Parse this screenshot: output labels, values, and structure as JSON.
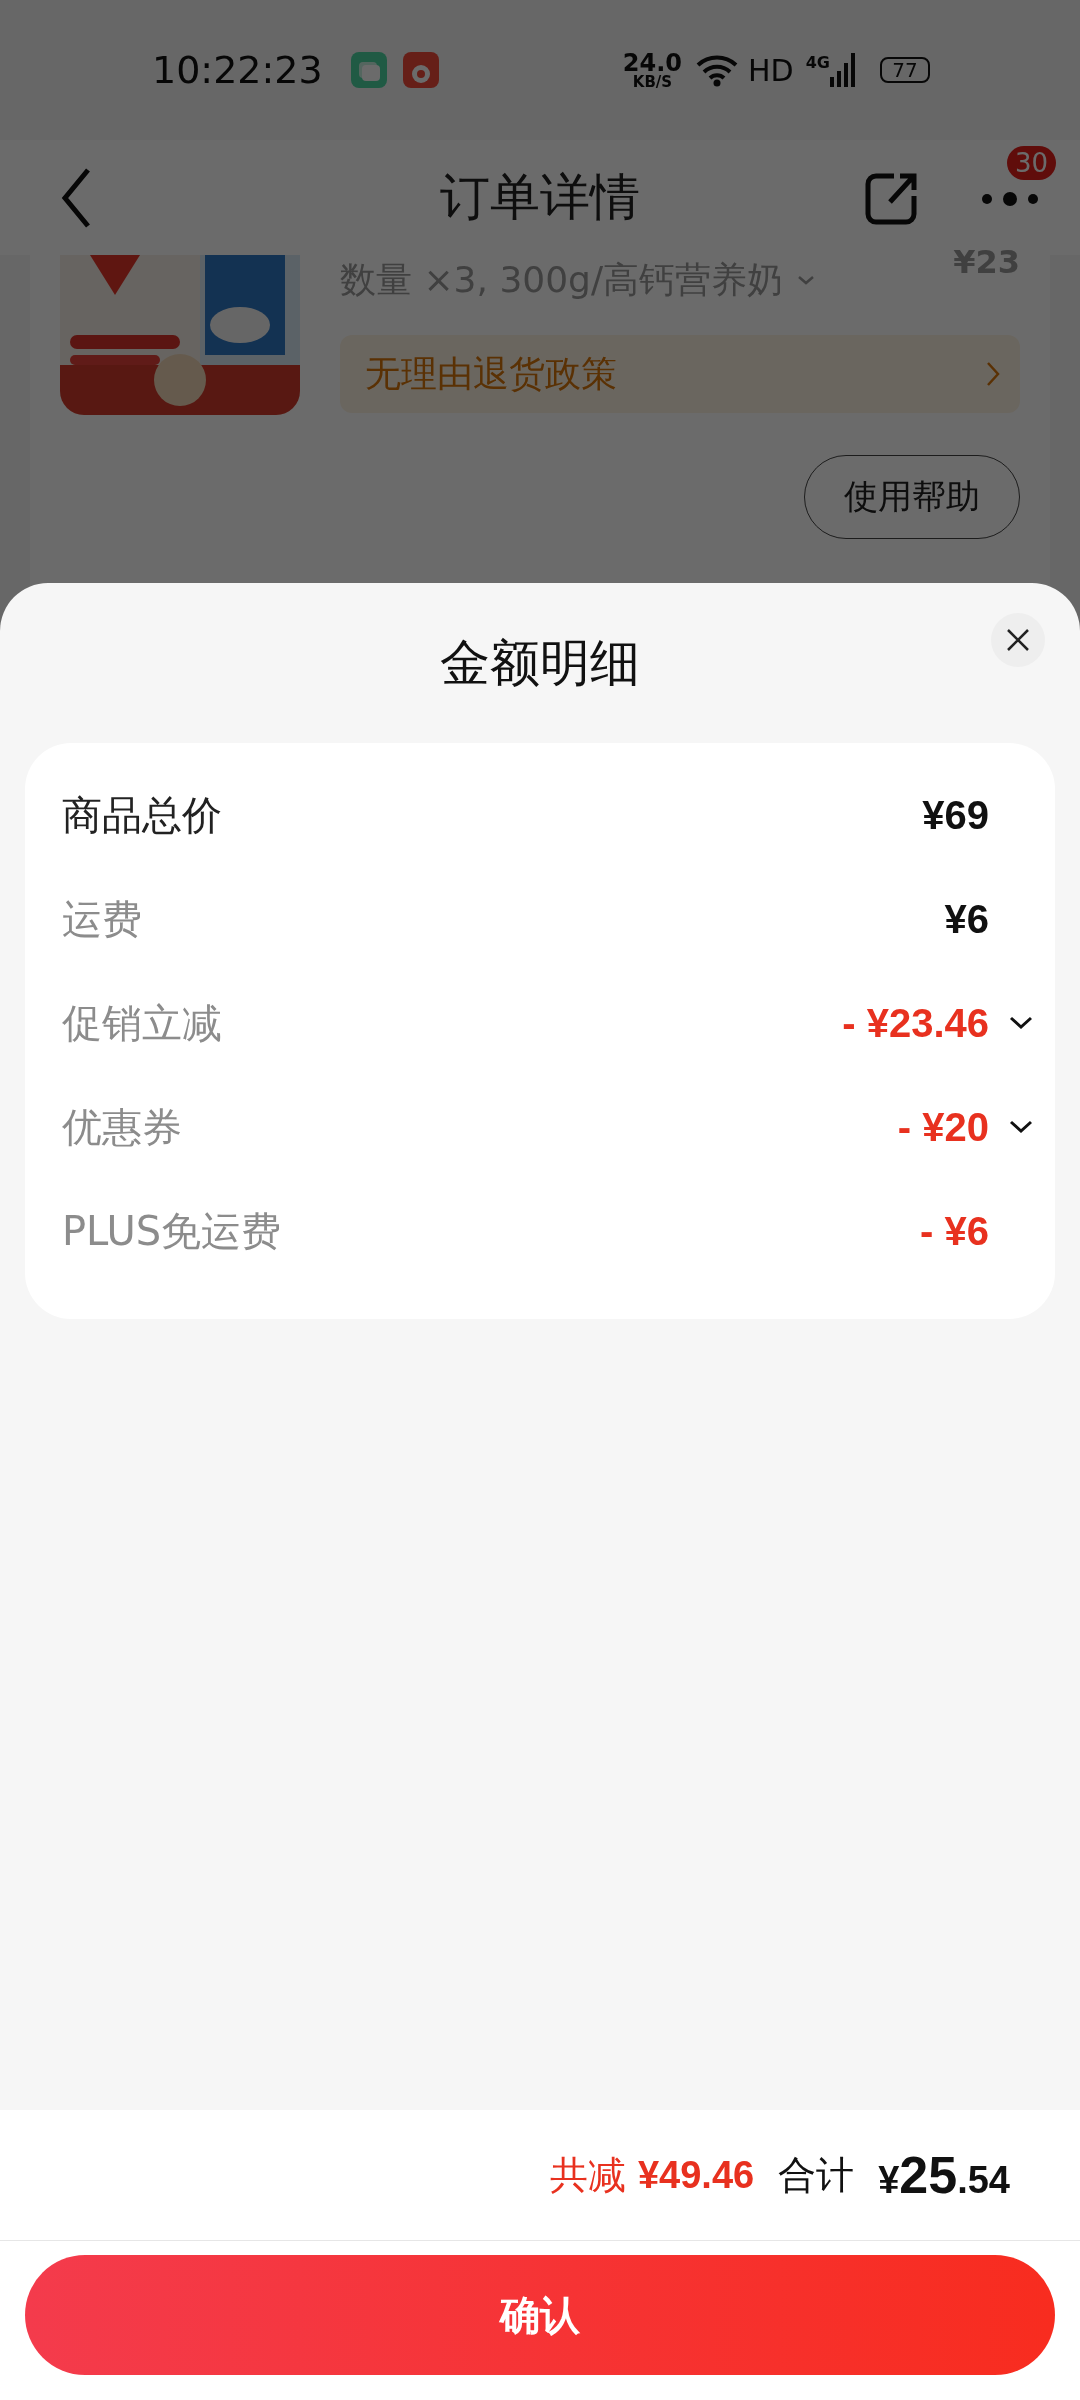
{
  "status_bar": {
    "time": "10:22:23",
    "speed": "24.0",
    "speed_unit": "KB/S",
    "hd": "HD",
    "network": "4G",
    "battery": "77"
  },
  "header": {
    "title": "订单详情",
    "badge": "30"
  },
  "order": {
    "spec": "数量 ×3, 300g/高钙营养奶",
    "price": "¥23",
    "policy": "无理由退货政策",
    "help_button": "使用帮助"
  },
  "sheet": {
    "title": "金额明细",
    "rows": [
      {
        "label": "商品总价",
        "value": "¥69",
        "highlighted": true,
        "deduction": false,
        "has_details": false
      },
      {
        "label": "运费",
        "value": "¥6",
        "highlighted": false,
        "deduction": false,
        "has_details": false
      },
      {
        "label": "促销立减",
        "value": "- ¥23.46",
        "highlighted": false,
        "deduction": true,
        "has_details": true
      },
      {
        "label": "优惠券",
        "value": "- ¥20",
        "highlighted": false,
        "deduction": true,
        "has_details": true
      },
      {
        "label": "PLUS免运费",
        "value": "- ¥6",
        "highlighted": false,
        "deduction": true,
        "has_details": false
      }
    ]
  },
  "summary": {
    "discount_label": "共减",
    "discount_value": "¥49.46",
    "total_label": "合计",
    "total_currency": "¥",
    "total_integer": "25",
    "total_decimal": ".54"
  },
  "confirm_button": "确认"
}
